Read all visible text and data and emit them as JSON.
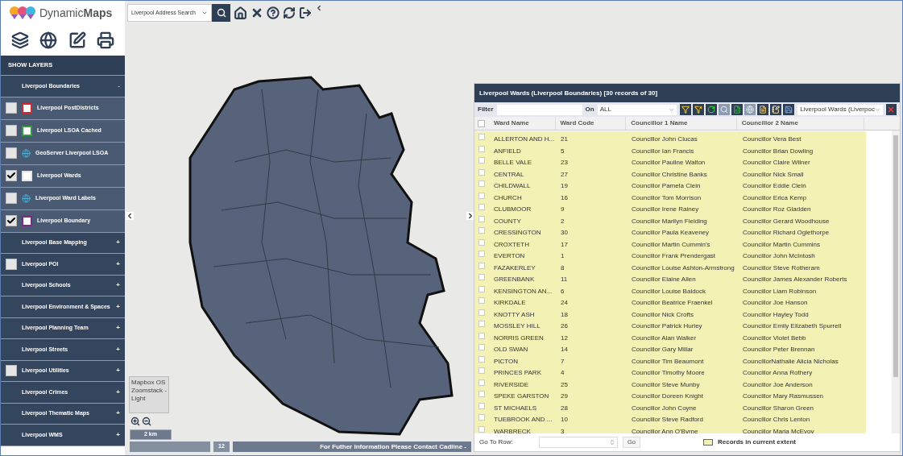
{
  "app": {
    "logo": "Dynamic**Maps**"
  },
  "search": {
    "value": "Liverpool Address Search"
  },
  "sidebar": {
    "heading": "SHOW LAYERS",
    "layers": [
      {
        "kind": "group",
        "label": "Liverpool Boundaries",
        "toggle": "-",
        "expanded": true,
        "children": [
          {
            "kind": "swatch-layer",
            "label": "Liverpool PostDistricts",
            "checked": false,
            "color": "#d9262b"
          },
          {
            "kind": "swatch-layer",
            "label": "Liverpool LSOA Cached",
            "checked": false,
            "color": "#2e9e3e"
          },
          {
            "kind": "globe-layer",
            "label": "GeoServer Liverpool LSOA",
            "checked": false
          },
          {
            "kind": "swatch-layer",
            "label": "Liverpool Wards",
            "checked": true,
            "color": "#e6e6e6"
          },
          {
            "kind": "globe-layer",
            "label": "Liverpool Ward Labels",
            "checked": false
          },
          {
            "kind": "swatch-layer",
            "label": "Liverpool Boundary",
            "checked": true,
            "color": "#7b2a8a"
          }
        ]
      },
      {
        "kind": "group",
        "label": "Liverpool Base Mapping",
        "toggle": "+",
        "expanded": false
      },
      {
        "kind": "group-check",
        "label": "Liverpool POI",
        "toggle": "+",
        "expanded": false,
        "checked": false
      },
      {
        "kind": "group",
        "label": "Liverpool Schools",
        "toggle": "+",
        "expanded": false
      },
      {
        "kind": "group",
        "label": "Liverpool Environment & Spaces",
        "toggle": "+",
        "expanded": false
      },
      {
        "kind": "group",
        "label": "Liverpool Planning Team",
        "toggle": "+",
        "expanded": false
      },
      {
        "kind": "group",
        "label": "Liverpool Streets",
        "toggle": "+",
        "expanded": false
      },
      {
        "kind": "group-check",
        "label": "Liverpool Utilities",
        "toggle": "+",
        "expanded": false,
        "checked": false
      },
      {
        "kind": "group",
        "label": "Liverpool Crimes",
        "toggle": "+",
        "expanded": false
      },
      {
        "kind": "group",
        "label": "Liverpool Thematic Maps",
        "toggle": "+",
        "expanded": false
      },
      {
        "kind": "group",
        "label": "Liverpool WMS",
        "toggle": "+",
        "expanded": false
      }
    ]
  },
  "map": {
    "basemap_label": "Mapbox OS Zoomstack - Light",
    "scale": "2 km",
    "zoom_level": "12",
    "info": "For Futher Information Please Contact Cadline -"
  },
  "grid": {
    "title": "Liverpool Wards (Liverpool Boundaries) [30 records of 30]",
    "filter_label": "Filter",
    "on_label": "On",
    "on_value": "ALL",
    "tools": [
      {
        "kind": "filter",
        "disabled": false
      },
      {
        "kind": "clear-filter",
        "disabled": false
      },
      {
        "kind": "refresh",
        "disabled": false
      },
      {
        "kind": "zoom",
        "disabled": true
      },
      {
        "kind": "spreadsheet",
        "disabled": false
      },
      {
        "kind": "globe",
        "disabled": true
      },
      {
        "kind": "document",
        "disabled": false
      },
      {
        "kind": "notes",
        "disabled": false
      },
      {
        "kind": "save",
        "disabled": false
      }
    ],
    "layer_value": "Liverpool Wards (Liverpoc",
    "all_selected": false,
    "columns": [
      "Ward Name",
      "Ward Code",
      "Councillor 1 Name",
      "Councillor 2 Name"
    ],
    "rows": [
      {
        "selected": false,
        "cells": [
          "ALLERTON AND H...",
          "21",
          "Councillor John Clucas",
          "Councillor Vera Best"
        ]
      },
      {
        "selected": false,
        "cells": [
          "ANFIELD",
          "5",
          "Councillor Ian Francis",
          "Councillor Brian Dowling"
        ]
      },
      {
        "selected": false,
        "cells": [
          "BELLE VALE",
          "23",
          "Councillor Pauline Walton",
          "Councillor Claire Wilner"
        ]
      },
      {
        "selected": false,
        "cells": [
          "CENTRAL",
          "27",
          "Councillor Christine Banks",
          "Councillor Nick Small"
        ]
      },
      {
        "selected": false,
        "cells": [
          "CHILDWALL",
          "19",
          "Councillor Pamela Clein",
          "Councillor Eddie Clein"
        ]
      },
      {
        "selected": false,
        "cells": [
          "CHURCH",
          "16",
          "Councillor Tom Morrison",
          "Councillor Erica Kemp"
        ]
      },
      {
        "selected": false,
        "cells": [
          "CLUBMOOR",
          "9",
          "Councillor Irene Rainey",
          "Councillor Roz Gladden"
        ]
      },
      {
        "selected": false,
        "cells": [
          "COUNTY",
          "2",
          "Councillor Marilyn Fielding",
          "Councillor Gerard Woodhouse"
        ]
      },
      {
        "selected": false,
        "cells": [
          "CRESSINGTON",
          "30",
          "Councillor Paula Keaveney",
          "Councillor Richard Oglethorpe"
        ]
      },
      {
        "selected": false,
        "cells": [
          "CROXTETH",
          "17",
          "Councillor Martin Cummin's",
          "Councillor Martin Cummins"
        ]
      },
      {
        "selected": false,
        "cells": [
          "EVERTON",
          "1",
          "Councillor Frank Prendergast",
          "Councillor John McIntosh"
        ]
      },
      {
        "selected": false,
        "cells": [
          "FAZAKERLEY",
          "8",
          "Councillor Louise Ashton-Armstrong",
          "Councillor Steve Rotheram"
        ]
      },
      {
        "selected": false,
        "cells": [
          "GREENBANK",
          "11",
          "Councillor Elaine Allen",
          "Councillor James Alexander Roberts"
        ]
      },
      {
        "selected": false,
        "cells": [
          "KENSINGTON AN...",
          "6",
          "Councillor Louise Baldock",
          "Councillor Liam Robinson"
        ]
      },
      {
        "selected": false,
        "cells": [
          "KIRKDALE",
          "24",
          "Councillor Beatrice Fraenkel",
          "Councillor Joe Hanson"
        ]
      },
      {
        "selected": false,
        "cells": [
          "KNOTTY ASH",
          "18",
          "Councillor Nick Crofts",
          "Councillor Hayley Todd"
        ]
      },
      {
        "selected": false,
        "cells": [
          "MOSSLEY HILL",
          "26",
          "Councillor Patrick Hurley",
          "Councillor Emily Elizabeth Spurrell"
        ]
      },
      {
        "selected": false,
        "cells": [
          "NORRIS GREEN",
          "12",
          "Councillor Alan Walker",
          "Councillor Violet Bebb"
        ]
      },
      {
        "selected": false,
        "cells": [
          "OLD SWAN",
          "14",
          "Councillor Gary Millar",
          "Councillor Peter Brennan"
        ]
      },
      {
        "selected": false,
        "cells": [
          "PICTON",
          "7",
          "Councillor Tim Beaumont",
          "CouncillorNathalie Alicia Nicholas"
        ]
      },
      {
        "selected": false,
        "cells": [
          "PRINCES PARK",
          "4",
          "Councillor Timothy Moore",
          "Councillor Anna Rothery"
        ]
      },
      {
        "selected": false,
        "cells": [
          "RIVERSIDE",
          "25",
          "Councillor Steve Munby",
          "Councillor Joe Anderson"
        ]
      },
      {
        "selected": false,
        "cells": [
          "SPEKE GARSTON",
          "29",
          "Councillor Doreen Knight",
          "Councillor Mary Rasmussen"
        ]
      },
      {
        "selected": false,
        "cells": [
          "ST MICHAELS",
          "28",
          "Councillor John Coyne",
          "Councillor Sharon Green"
        ]
      },
      {
        "selected": false,
        "cells": [
          "TUEBROOK AND ...",
          "10",
          "Councillor Steve Radford",
          "Councillor Chris Lenton"
        ]
      },
      {
        "selected": false,
        "cells": [
          "WARBRECK",
          "3",
          "Councillor Ann O'Byrne",
          "Councillor Maria McEvoy"
        ]
      }
    ],
    "goto_label": "Go To Row:",
    "go_button": "Go",
    "legend": "Records in current extent"
  }
}
